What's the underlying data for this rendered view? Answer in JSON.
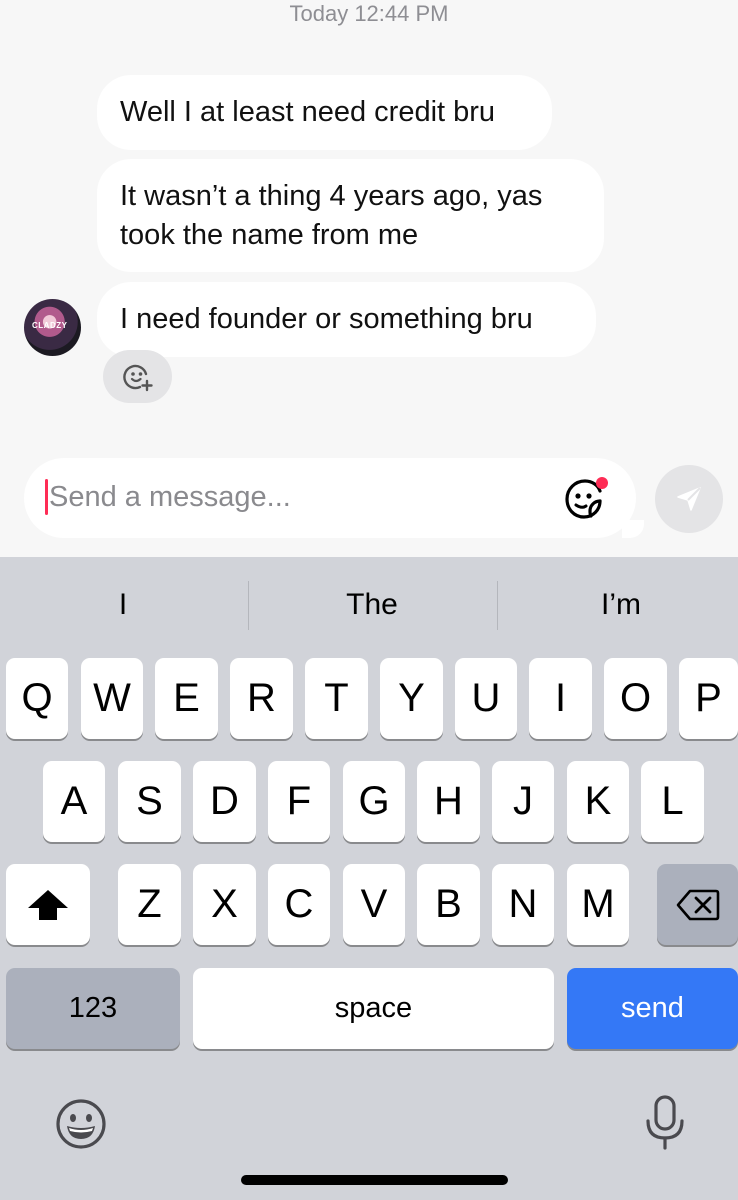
{
  "chat": {
    "timestamp": "Today 12:44 PM",
    "messages": [
      {
        "text": "Well I at least need credit bru"
      },
      {
        "text": "It wasn’t a thing 4 years ago, yas took the name from me"
      },
      {
        "text": "I need founder or something bru"
      }
    ],
    "avatar_badge": "CLADZY"
  },
  "composer": {
    "placeholder": "Send a message..."
  },
  "keyboard": {
    "suggestions": [
      "I",
      "The",
      "I’m"
    ],
    "row1": [
      "Q",
      "W",
      "E",
      "R",
      "T",
      "Y",
      "U",
      "I",
      "O",
      "P"
    ],
    "row2": [
      "A",
      "S",
      "D",
      "F",
      "G",
      "H",
      "J",
      "K",
      "L"
    ],
    "row3": [
      "Z",
      "X",
      "C",
      "V",
      "B",
      "N",
      "M"
    ],
    "numbers_label": "123",
    "space_label": "space",
    "send_label": "send"
  },
  "colors": {
    "accent_cursor": "#fe2c55",
    "send_key": "#3478f6",
    "notification_dot": "#fe2c55"
  },
  "icons": [
    "add-reaction-icon",
    "sticker-icon",
    "send-arrow-icon",
    "shift-icon",
    "backspace-icon",
    "emoji-icon",
    "microphone-icon"
  ]
}
